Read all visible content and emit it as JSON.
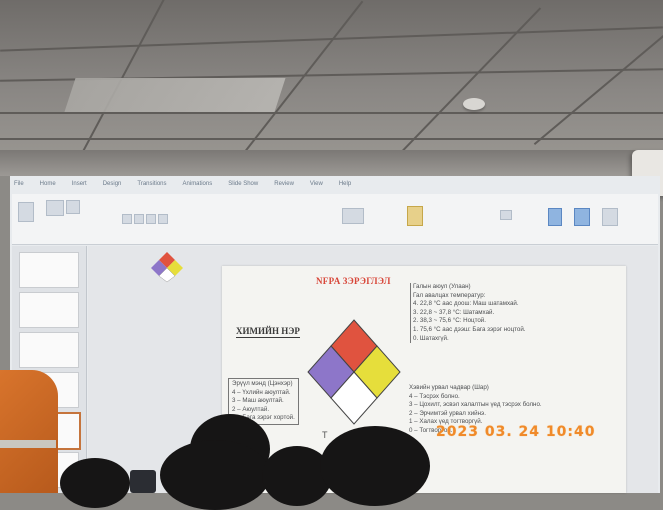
{
  "ribbon": {
    "tabs": [
      "File",
      "Home",
      "Insert",
      "Design",
      "Transitions",
      "Animations",
      "Slide Show",
      "Review",
      "View",
      "Help"
    ]
  },
  "slide": {
    "nfpa_title": "NFPA ЗЭРЭГЛЭЛ",
    "chemical_name": "ХИМИЙН НЭР",
    "health": [
      "Галын аюул (Улаан)",
      "Гал авалцах температур:",
      "4. 22,8 °C аас доош: Маш шатамхай.",
      "3. 22,8 ~ 37,8 °C: Шатамхай.",
      "2. 38,3 ~ 75,6 °C: Ноцтой.",
      "1. 75,6 °C аас дээш: Бага зэрэг ноцтой.",
      "0. Шатахгүй."
    ],
    "reactivity": [
      "Хэвийн урвал чадвар (Шар)",
      "4 – Тэсрэх болно.",
      "3 – Цохилт, эсвэл халалтын үед тэсрэх болно.",
      "2 – Эрчимтэй урвал хийнэ.",
      "1 – Халах үед тогтворгүй.",
      "0 – Тогтвортой."
    ],
    "flammability": [
      "Эрүүл мэнд (Цэнхэр)",
      "4 – Үхлийн аюултай.",
      "3 – Маш аюултай.",
      "2 – Аюултай.",
      "1 – Бага зэрэг хортой."
    ],
    "bottom_char": "Т"
  },
  "stamp": "2023 03. 24 10:40",
  "colors": {
    "fire": "#e0533f",
    "health": "#8d76c9",
    "reactivity": "#e6de3b",
    "special": "#ffffff",
    "stamp": "#f08a2a"
  }
}
